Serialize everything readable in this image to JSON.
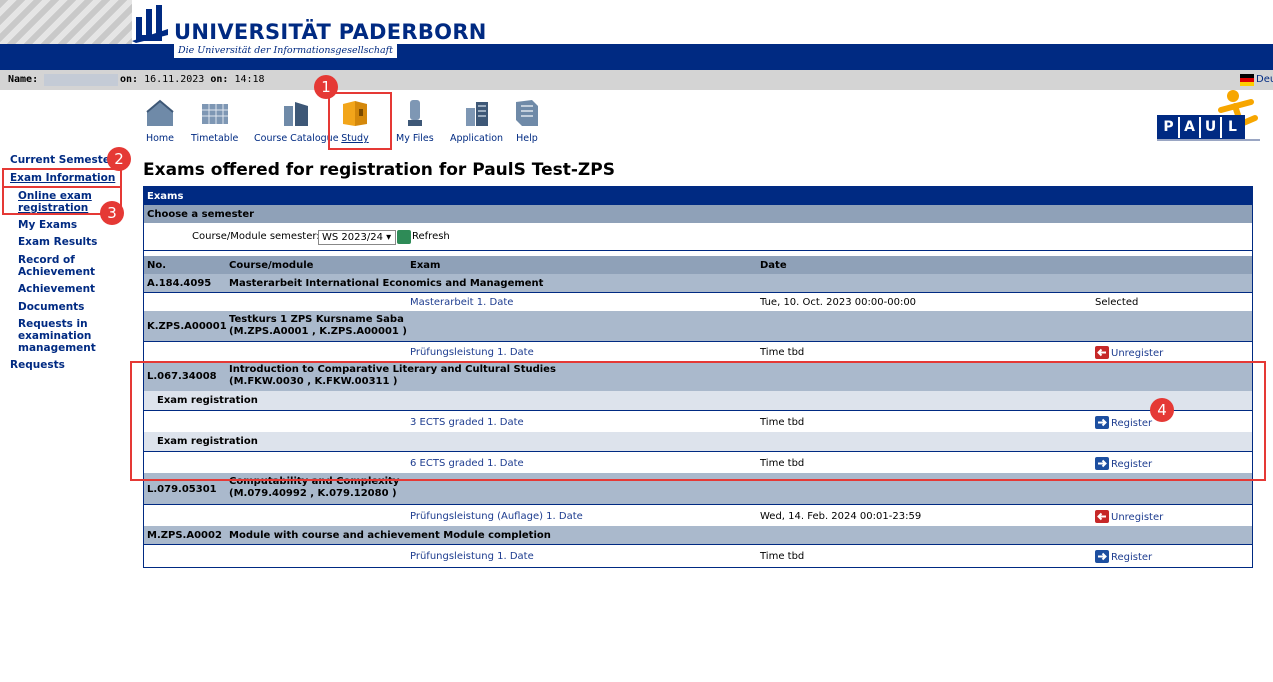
{
  "header": {
    "university_name": "UNIVERSITÄT PADERBORN",
    "university_subtitle": "Die Universität der Informationsgesellschaft"
  },
  "infobar": {
    "name_label": "Name:",
    "date_prefix": "on:",
    "date_value": "16.11.2023",
    "time_prefix": "on:",
    "time_value": "14:18",
    "language_label": "Deu"
  },
  "nav": [
    {
      "label": "Home",
      "icon": "home-icon"
    },
    {
      "label": "Timetable",
      "icon": "timetable-icon"
    },
    {
      "label": "Course Catalogue",
      "icon": "course-catalogue-icon"
    },
    {
      "label": "Study",
      "icon": "study-icon"
    },
    {
      "label": "My Files",
      "icon": "my-files-icon"
    },
    {
      "label": "Application",
      "icon": "application-icon"
    },
    {
      "label": "Help",
      "icon": "help-icon"
    }
  ],
  "paul_logo": "PAUL",
  "sidebar": {
    "items": [
      {
        "label": "Current Semester"
      },
      {
        "label": "Exam Information"
      },
      {
        "label": "Online exam registration"
      },
      {
        "label": "My Exams"
      },
      {
        "label": "Exam Results"
      },
      {
        "label": "Record of Achievement"
      },
      {
        "label": "Achievement"
      },
      {
        "label": "Documents"
      },
      {
        "label": "Requests in examination management"
      },
      {
        "label": "Requests"
      }
    ]
  },
  "page_title": "Exams offered for registration for PaulS Test-ZPS",
  "table": {
    "section_title": "Exams",
    "choose_semester": "Choose a semester",
    "semester_label": "Course/Module semester:",
    "semester_value": "WS 2023/24",
    "refresh_label": "Refresh",
    "columns": [
      "No.",
      "Course/module",
      "Exam",
      "Date"
    ],
    "rows": {
      "masterarbeit": {
        "no": "A.184.4095",
        "course": "Masterarbeit International Economics and Management",
        "exam": "Masterarbeit 1. Date",
        "date": "Tue, 10. Oct. 2023 00:00-00:00",
        "status": "Selected"
      },
      "testkurs": {
        "no": "K.ZPS.A00001",
        "course_line1": "Testkurs 1 ZPS Kursname Saba",
        "course_line2": "(M.ZPS.A0001 , K.ZPS.A00001 )",
        "exam": "Prüfungsleistung 1. Date",
        "date": "Time tbd",
        "action": "Unregister"
      },
      "comparative": {
        "no": "L.067.34008",
        "course_line1": "Introduction to Comparative Literary and Cultural Studies",
        "course_line2": "(M.FKW.0030 , K.FKW.00311 )",
        "sub1_label": "Exam registration",
        "exam1": "3 ECTS graded 1. Date",
        "date1": "Time tbd",
        "action1": "Register",
        "sub2_label": "Exam registration",
        "exam2": "6 ECTS graded 1. Date",
        "date2": "Time tbd",
        "action2": "Register"
      },
      "computability": {
        "no": "L.079.05301",
        "course_line1": "Computability and Complexity",
        "course_line2": "(M.079.40992 , K.079.12080 )",
        "exam": "Prüfungsleistung (Auflage) 1. Date",
        "date": "Wed, 14. Feb. 2024 00:01-23:59",
        "action": "Unregister"
      },
      "module": {
        "no": "M.ZPS.A0002",
        "course": "Module with course and achievement Module completion",
        "exam": "Prüfungsleistung 1. Date",
        "date": "Time tbd",
        "action": "Register"
      }
    }
  },
  "annotations": [
    "1",
    "2",
    "3",
    "4"
  ],
  "colors": {
    "brand": "#002a82",
    "annotation": "#e53935"
  }
}
